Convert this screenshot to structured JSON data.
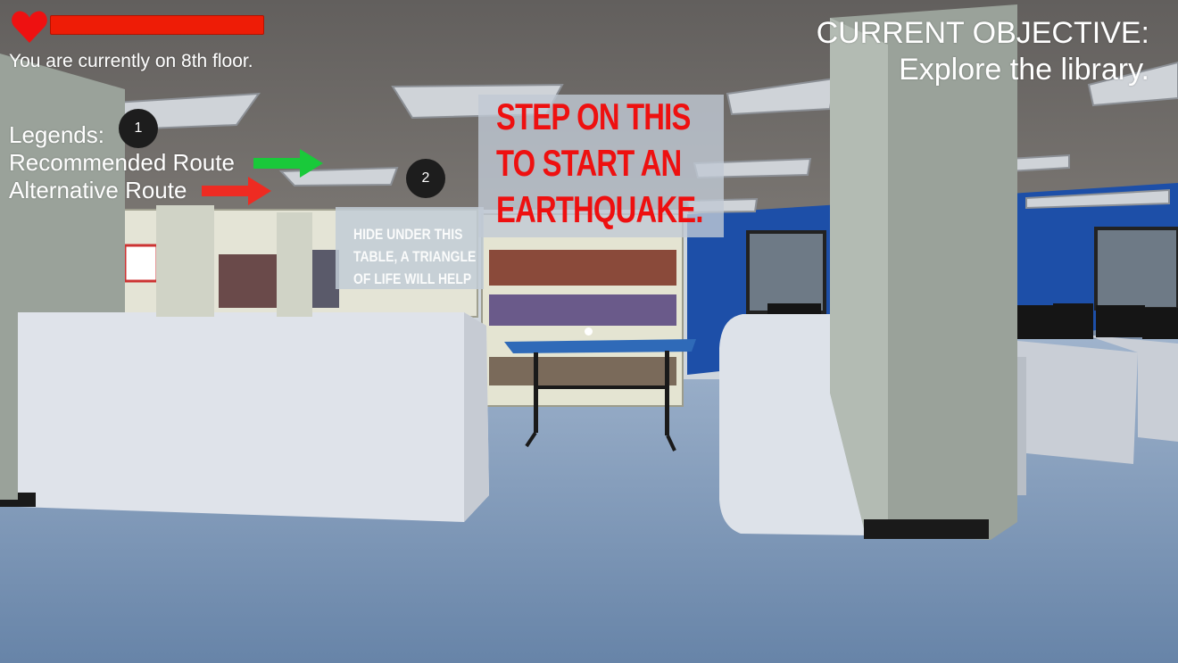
{
  "hud": {
    "health_fraction": 1.0,
    "floor_text": "You are currently on 8th floor.",
    "legend_title": "Legends:",
    "legend_recommended": "Recommended Route",
    "legend_alternative": "Alternative Route",
    "objective_title": "CURRENT OBJECTIVE:",
    "objective_text": "Explore the library."
  },
  "markers": [
    "1",
    "2"
  ],
  "world_signs": {
    "earthquake_line1": "STEP ON THIS",
    "earthquake_line2": "TO START AN",
    "earthquake_line3": "EARTHQUAKE.",
    "hide_line1": "HIDE UNDER THIS",
    "hide_line2": "TABLE, A TRIANGLE",
    "hide_line3": "OF LIFE WILL HELP"
  },
  "colors": {
    "health": "#ee1c06",
    "heart": "#ee1111",
    "recommended_arrow": "#19c93a",
    "alternative_arrow": "#ee2b22",
    "sign_text": "#ee1010",
    "ceiling": "#6e6a67",
    "floor": "#7f98b8",
    "wall_blue": "#1d4fa8",
    "pillar": "#9aa29a"
  },
  "icons": {
    "heart": "heart-icon",
    "recommended_arrow": "green-arrow-icon",
    "alternative_arrow": "red-arrow-icon"
  }
}
